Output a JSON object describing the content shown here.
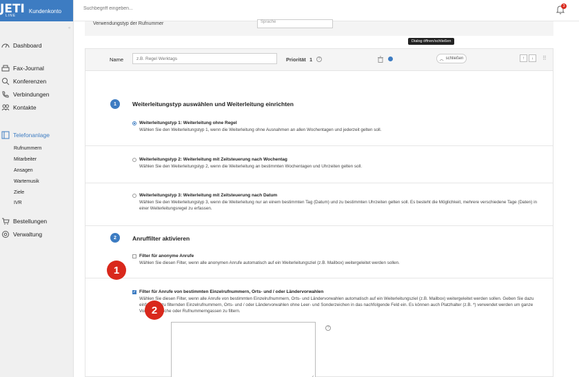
{
  "brand": {
    "logo": "JETI",
    "logo_sub": "LINE",
    "label": "Kundenkonto"
  },
  "search": {
    "placeholder": "Suchbegriff eingeben..."
  },
  "notifications": {
    "count": "3"
  },
  "sidebar": {
    "items": [
      {
        "label": "Dashboard",
        "icon": "dashboard-icon"
      },
      {
        "label": "Fax-Journal",
        "icon": "fax-icon"
      },
      {
        "label": "Konferenzen",
        "icon": "conference-icon"
      },
      {
        "label": "Verbindungen",
        "icon": "phone-icon"
      },
      {
        "label": "Kontakte",
        "icon": "contacts-icon"
      },
      {
        "label": "Telefonanlage",
        "icon": "pbx-icon",
        "active": true
      },
      {
        "label": "Bestellungen",
        "icon": "cart-icon"
      },
      {
        "label": "Verwaltung",
        "icon": "gear-icon"
      }
    ],
    "sub_items": [
      "Rufnummern",
      "Mitarbeiter",
      "Ansagen",
      "Wartemusik",
      "Ziele",
      "IVR"
    ]
  },
  "prev_panel": {
    "label": "Verwendungstyp der Rufnummer",
    "select_value": "Sprache"
  },
  "rule": {
    "name_label": "Name",
    "name_placeholder": "z.B. Regel Werktags",
    "priority_label": "Priorität",
    "priority_value": "1",
    "tooltip": "Dialog öffnen/schließen",
    "close_label": "schließen",
    "up": "↑",
    "down": "↓",
    "drag": "⠿"
  },
  "section1": {
    "number": "1",
    "title": "Weiterleitungstyp auswählen und Weiterleitung einrichten",
    "options": [
      {
        "title": "Weiterleitungstyp 1: Weiterleitung ohne Regel",
        "desc": "Wählen Sie den Weiterleitungstyp 1, wenn die Weiterleitung ohne Ausnahmen an allen Wochentagen und jederzeit gelten soll.",
        "checked": true
      },
      {
        "title": "Weiterleitungstyp 2: Weiterleitung mit Zeitsteuerung nach Wochentag",
        "desc": "Wählen Sie den Weiterleitungstyp 2, wenn die Weiterleitung an bestimmten Wochentagen und Uhrzeiten gelten soll.",
        "checked": false
      },
      {
        "title": "Weiterleitungstyp 3: Weiterleitung mit Zeitsteuerung nach Datum",
        "desc": "Wählen Sie den Weiterleitungstyp 3, wenn die Weiterleitung nur an einem bestimmten Tag (Datum) und zu bestimmten Uhrzeiten gelten soll. Es besteht die Möglichkeit, mehrere verschiedene Tage (Daten) in einer Weiterleitungsregel zu erfassen.",
        "checked": false
      }
    ]
  },
  "section2": {
    "number": "2",
    "title": "Anruffilter aktivieren",
    "filters": [
      {
        "title": "Filter für anonyme Anrufe",
        "desc": "Wählen Sie diesen Filter, wenn alle anonymen Anrufe automatisch auf ein Weiterleitungsziel (z.B. Mailbox) weitergeleitet werden sollen.",
        "checked": false
      },
      {
        "title": "Filter für Anrufe von bestimmten Einzelrufnummern, Orts- und / oder Ländervorwahlen",
        "desc": "Wählen Sie diesen Filter, wenn alle Anrufe von bestimmten Einzelrufnummern, Orts- und Ländervorwahlen automatisch auf ein Weiterleitungsziel (z.B. Mailbox) weitergeleitet werden sollen. Geben Sie dazu einfach die zu filternden Einzelrufnummern, Orts- und / oder Ländervorwahlen ohne Leer- und Sonderzeichen in das nachfolgende Feld ein. Es können auch Platzhalter (z.B. *) verwendet werden um ganze Vorwahlbereiche oder Rufnummerngassen zu filtern.",
        "checked": true
      }
    ]
  },
  "badges": [
    "1",
    "2"
  ],
  "colors": {
    "primary": "#3d7cc2",
    "badge_red": "#d9281c"
  }
}
